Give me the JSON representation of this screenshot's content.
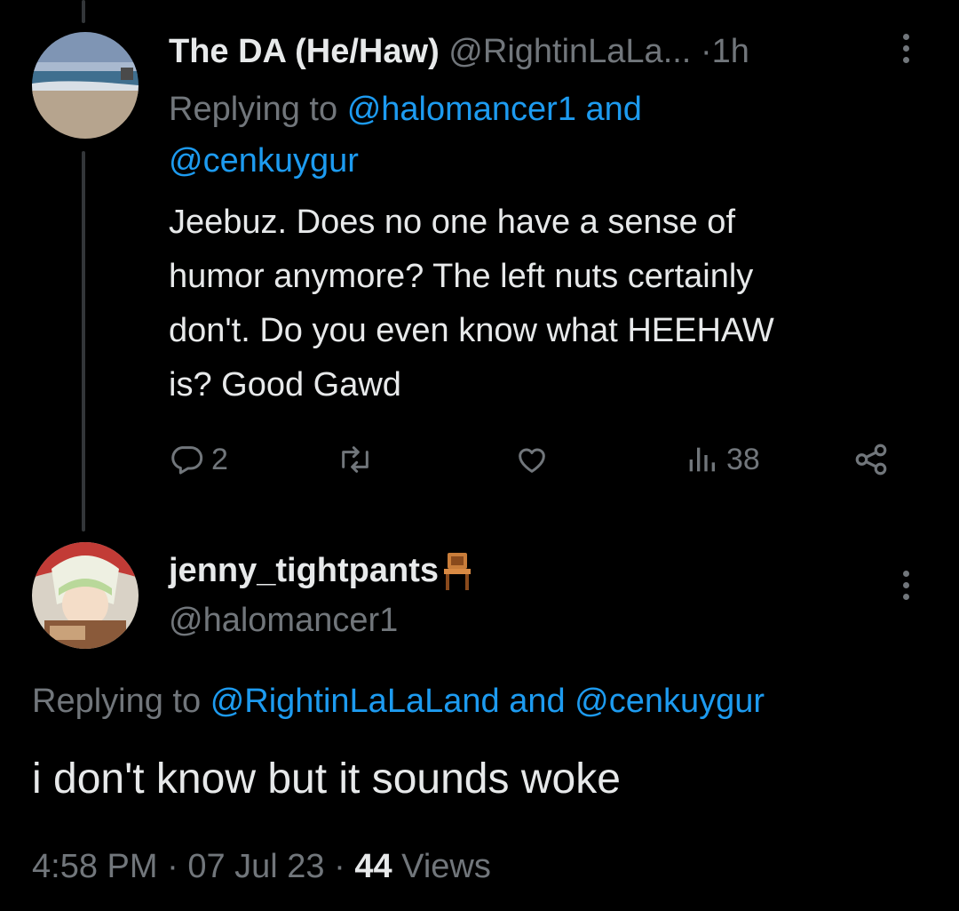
{
  "tweet1": {
    "display_name": "The DA (He/Haw)",
    "handle": "@RightinLaLa...",
    "separator": "·",
    "time": "1h",
    "replying_prefix": "Replying to",
    "replying_user1": "@halomancer1",
    "replying_and": "and",
    "replying_user2": "@cenkuygur",
    "body_line1": "Jeebuz. Does no one have a sense of",
    "body_line2": "humor anymore? The left nuts certainly",
    "body_line3": "don't. Do you even know what HEEHAW",
    "body_line4": "is? Good Gawd",
    "reply_count": "2",
    "views_count": "38",
    "icons": [
      "reply-icon",
      "retweet-icon",
      "like-icon",
      "views-icon",
      "share-icon",
      "more-icon"
    ]
  },
  "tweet2": {
    "display_name": "jenny_tightpants",
    "name_emoji": "chair-emoji",
    "handle": "@halomancer1",
    "replying_prefix": "Replying to",
    "replying_user1": "@RightinLaLaLand",
    "replying_and": "and",
    "replying_user2": "@cenkuygur",
    "body": "i don't know but it sounds woke",
    "time": "4:58 PM",
    "date": "07 Jul 23",
    "separator": "·",
    "views_count": "44",
    "views_label": "Views"
  },
  "colors": {
    "background": "#000000",
    "text": "#e7e9ea",
    "muted": "#71767b",
    "link": "#1d9bf0"
  }
}
